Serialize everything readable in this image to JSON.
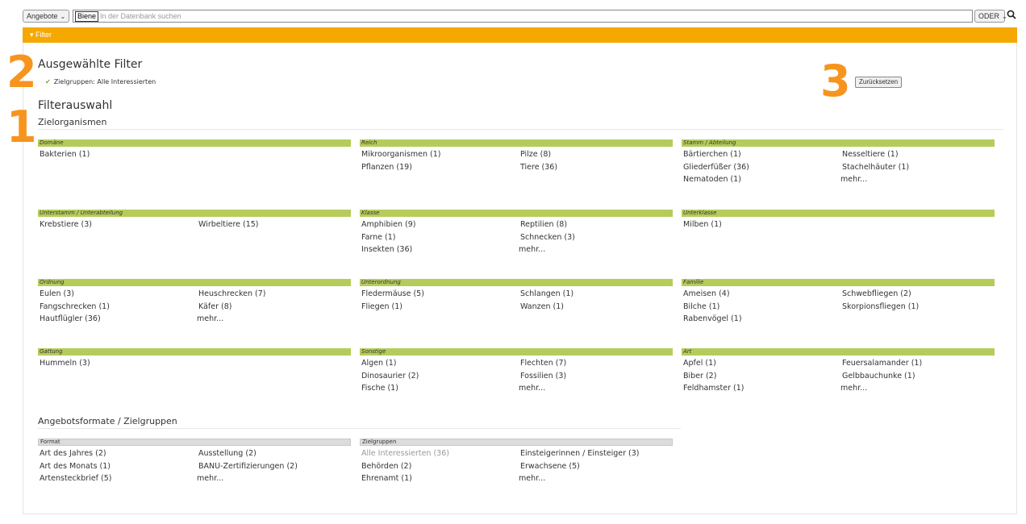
{
  "search": {
    "scope_select": "Angebote",
    "term": "Biene",
    "placeholder": "In der Datenbank suchen",
    "operator_select": "ODER"
  },
  "filterbar": {
    "label": "▾ Filter"
  },
  "annotations": {
    "n1": "1",
    "n2": "2",
    "n3": "3"
  },
  "selected": {
    "title": "Ausgewählte Filter",
    "items": [
      "Zielgruppen: Alle Interessierten"
    ],
    "reset_label": "Zurücksetzen"
  },
  "filterauswahl": {
    "title": "Filterauswahl",
    "zielorganismen_title": "Zielorganismen",
    "angebot_title": "Angebotsformate / Zielgruppen"
  },
  "groups": [
    {
      "key": "domaene",
      "label": "Domäne",
      "items": [
        "Bakterien (1)"
      ]
    },
    {
      "key": "reich",
      "label": "Reich",
      "items": [
        "Mikroorganismen (1)",
        "Pilze (8)",
        "Pflanzen (19)",
        "Tiere (36)"
      ]
    },
    {
      "key": "stamm",
      "label": "Stamm / Abteilung",
      "items": [
        "Bärtierchen (1)",
        "Nesseltiere (1)",
        "Gliederfüßer (36)",
        "Stachelhäuter (1)",
        "Nematoden (1)",
        "mehr..."
      ]
    },
    {
      "key": "unterstamm",
      "label": "Unterstamm / Unterabteilung",
      "items": [
        "Krebstiere (3)",
        "Wirbeltiere (15)"
      ]
    },
    {
      "key": "klasse",
      "label": "Klasse",
      "items": [
        "Amphibien (9)",
        "Reptilien (8)",
        "Farne (1)",
        "Schnecken (3)",
        "Insekten (36)",
        "mehr..."
      ]
    },
    {
      "key": "unterklasse",
      "label": "Unterklasse",
      "items": [
        "Milben (1)"
      ]
    },
    {
      "key": "ordnung",
      "label": "Ordnung",
      "items": [
        "Eulen (3)",
        "Heuschrecken (7)",
        "Fangschrecken (1)",
        "Käfer (8)",
        "Hautflügler (36)",
        "mehr..."
      ]
    },
    {
      "key": "unterordnung",
      "label": "Unterordnung",
      "items": [
        "Fledermäuse (5)",
        "Schlangen (1)",
        "Fliegen (1)",
        "Wanzen (1)"
      ]
    },
    {
      "key": "familie",
      "label": "Familie",
      "items": [
        "Ameisen (4)",
        "Schwebfliegen (2)",
        "Bilche (1)",
        "Skorpionsfliegen (1)",
        "Rabenvögel (1)"
      ]
    },
    {
      "key": "gattung",
      "label": "Gattung",
      "items": [
        "Hummeln (3)"
      ]
    },
    {
      "key": "sonstige",
      "label": "Sonstige",
      "items": [
        "Algen (1)",
        "Flechten (7)",
        "Dinosaurier (2)",
        "Fossilien (3)",
        "Fische (1)",
        "mehr..."
      ]
    },
    {
      "key": "art",
      "label": "Art",
      "items": [
        "Apfel (1)",
        "Feuersalamander (1)",
        "Biber (2)",
        "Gelbbauchunke (1)",
        "Feldhamster (1)",
        "mehr..."
      ]
    }
  ],
  "format_groups": [
    {
      "key": "format",
      "label": "Format",
      "items": [
        "Art des Jahres (2)",
        "Ausstellung (2)",
        "Art des Monats (1)",
        "BANU-Zertifizierungen (2)",
        "Artensteckbrief (5)",
        "mehr..."
      ]
    },
    {
      "key": "zielgruppen",
      "label": "Zielgruppen",
      "items": [
        "Alle Interessierten (36)",
        "Einsteigerinnen / Einsteiger (3)",
        "Behörden (2)",
        "Erwachsene (5)",
        "Ehrenamt (1)",
        "mehr..."
      ]
    }
  ]
}
